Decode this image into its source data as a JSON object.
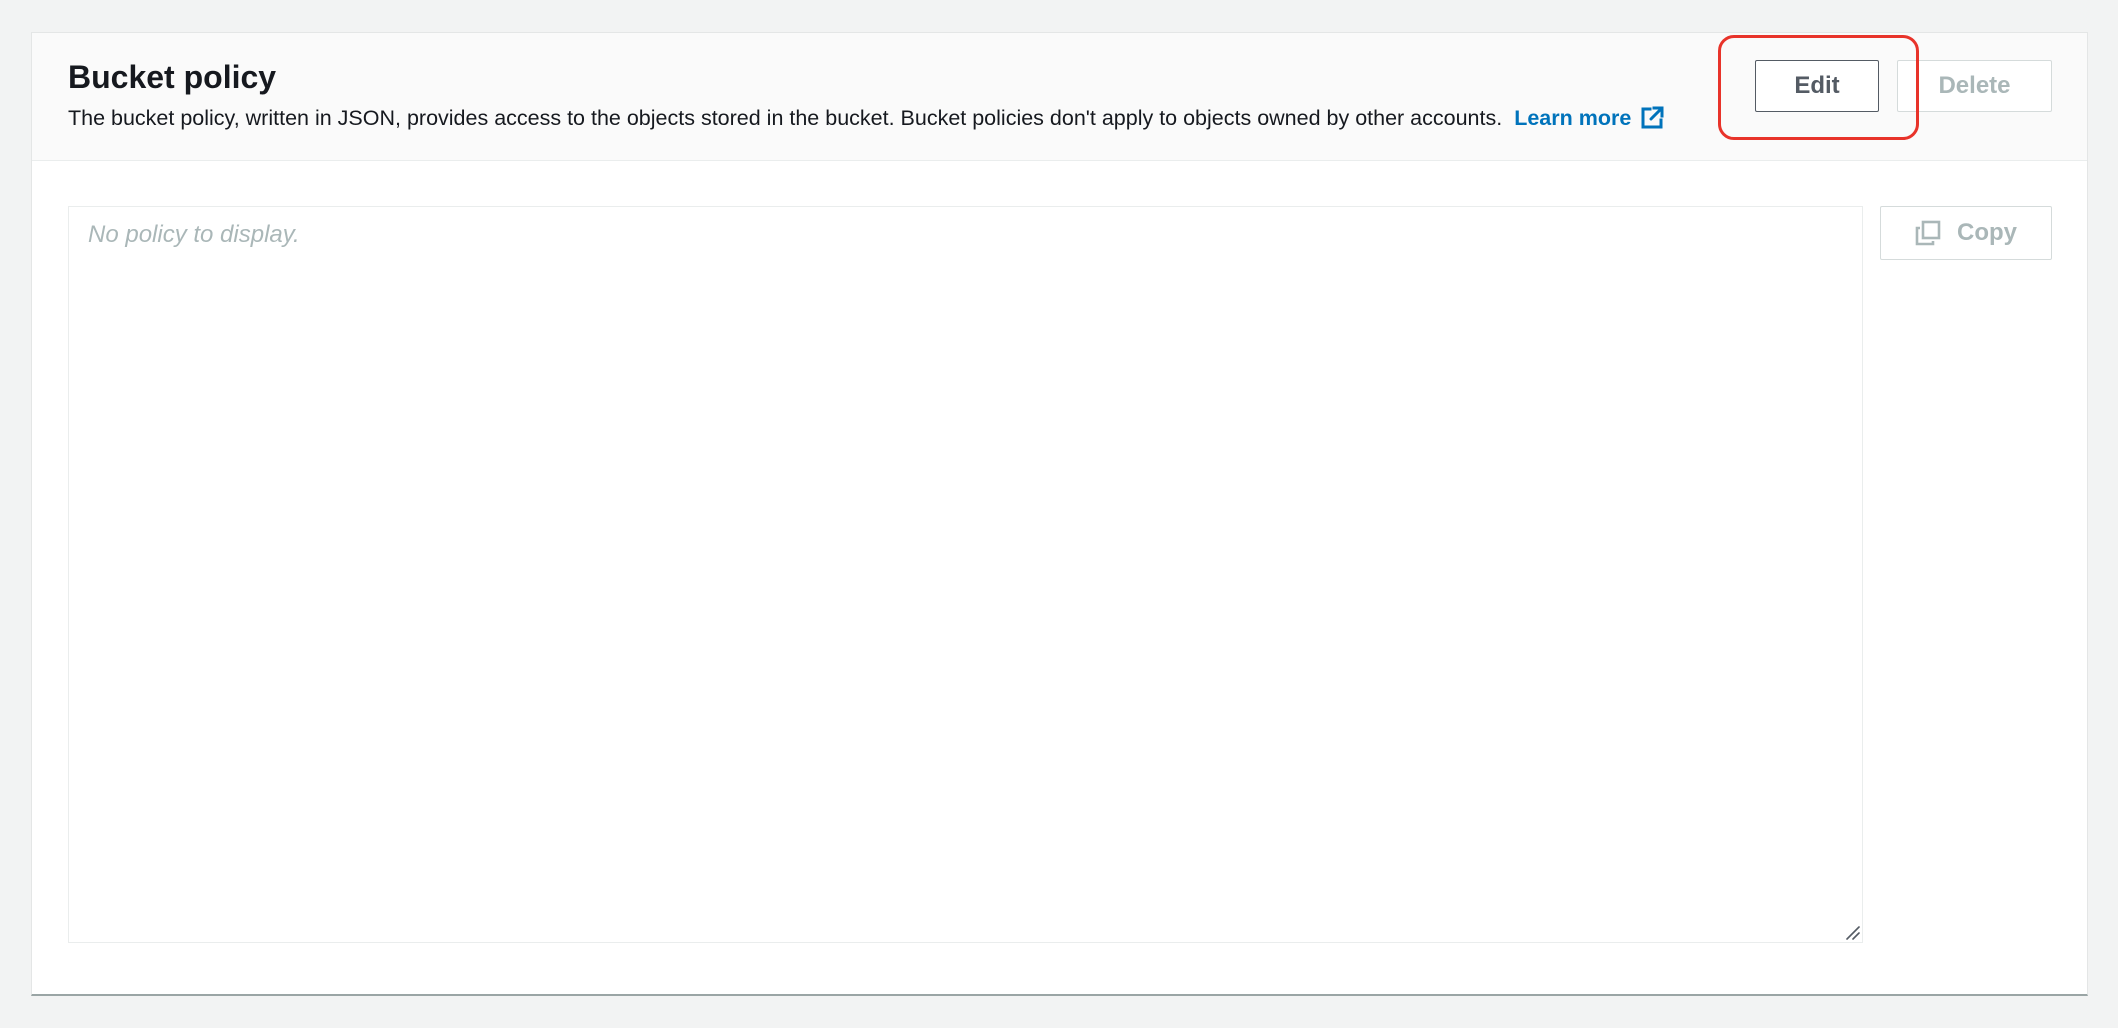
{
  "section": {
    "title": "Bucket policy",
    "description": "The bucket policy, written in JSON, provides access to the objects stored in the bucket. Bucket policies don't apply to objects owned by other accounts.",
    "learn_more": "Learn more"
  },
  "actions": {
    "edit_label": "Edit",
    "delete_label": "Delete",
    "copy_label": "Copy"
  },
  "policy": {
    "placeholder": "No policy to display."
  },
  "colors": {
    "link": "#0073bb",
    "highlight": "#e8332a",
    "disabled_text": "#aab7b8"
  },
  "icons": {
    "external_link": "external-link-icon",
    "copy": "copy-icon",
    "resize": "resize-handle-icon"
  }
}
